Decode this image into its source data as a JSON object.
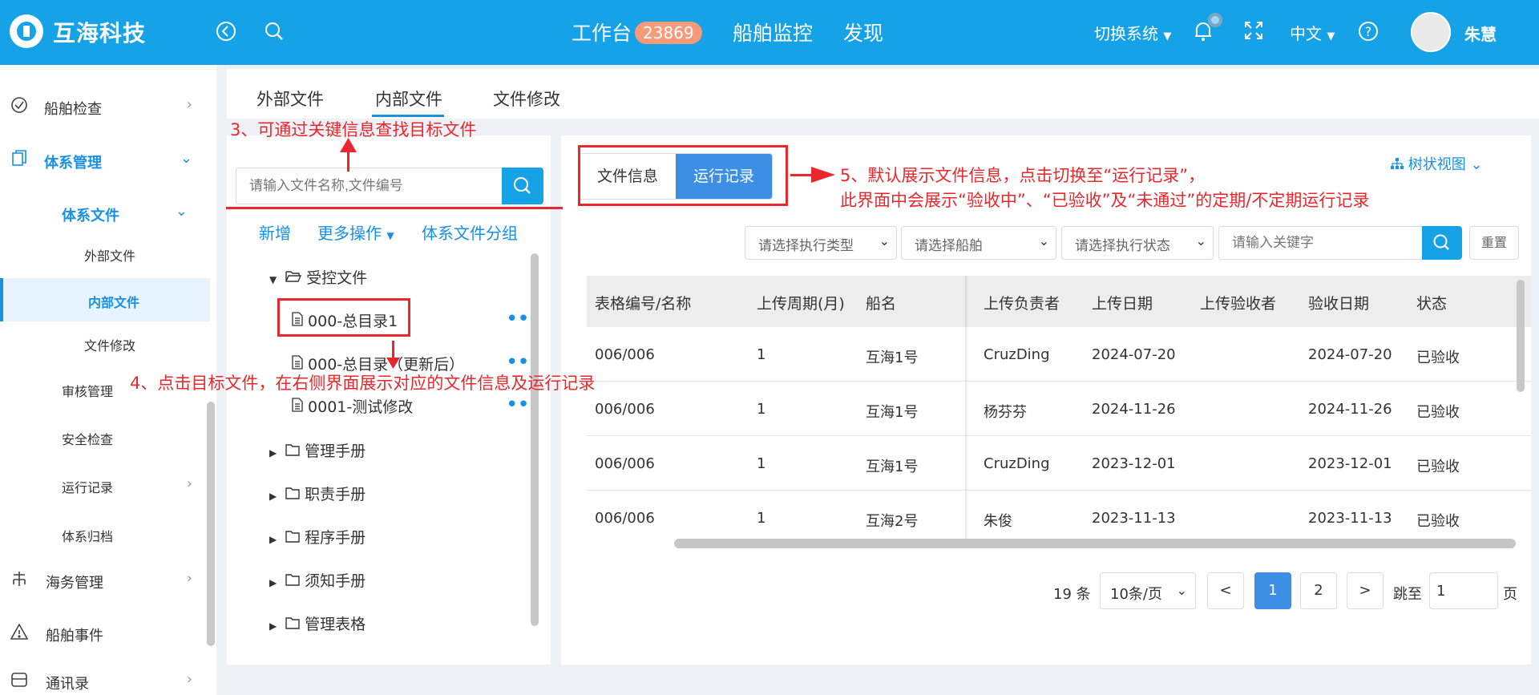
{
  "header": {
    "brand": "互海科技",
    "nav": [
      "工作台",
      "船舶监控",
      "发现"
    ],
    "badge": "23869",
    "switch_system": "切换系统",
    "language": "中文",
    "user": "朱慧"
  },
  "sidebar": {
    "items": [
      {
        "label": "船舶检查"
      },
      {
        "label": "体系管理"
      },
      {
        "label": "体系文件"
      },
      {
        "label": "外部文件"
      },
      {
        "label": "内部文件"
      },
      {
        "label": "文件修改"
      },
      {
        "label": "审核管理"
      },
      {
        "label": "安全检查"
      },
      {
        "label": "运行记录"
      },
      {
        "label": "体系归档"
      },
      {
        "label": "海务管理"
      },
      {
        "label": "船舶事件"
      },
      {
        "label": "通讯录"
      }
    ]
  },
  "tabs": [
    "外部文件",
    "内部文件",
    "文件修改"
  ],
  "left": {
    "search_placeholder": "请输入文件名称,文件编号",
    "actions": [
      "新增",
      "更多操作",
      "体系文件分组"
    ],
    "tree": {
      "root": "受控文件",
      "files": [
        "000-总目录1",
        "000-总目录（更新后）",
        "0001-测试修改"
      ],
      "folders": [
        "管理手册",
        "职责手册",
        "程序手册",
        "须知手册",
        "管理表格"
      ]
    }
  },
  "right": {
    "segments": [
      "文件信息",
      "运行记录"
    ],
    "tree_view": "树状视图",
    "filters": [
      "请选择执行类型",
      "请选择船舶",
      "请选择执行状态"
    ],
    "keyword_placeholder": "请输入关键字",
    "reset": "重置",
    "columns": [
      "表格编号/名称",
      "上传周期(月)",
      "船名",
      "上传负责者",
      "上传日期",
      "上传验收者",
      "验收日期",
      "状态"
    ],
    "rows": [
      [
        "006/006",
        "1",
        "互海1号",
        "CruzDing",
        "2024-07-20",
        "",
        "2024-07-20",
        "已验收"
      ],
      [
        "006/006",
        "1",
        "互海1号",
        "杨芬芬",
        "2024-11-26",
        "",
        "2024-11-26",
        "已验收"
      ],
      [
        "006/006",
        "1",
        "互海1号",
        "CruzDing",
        "2023-12-01",
        "",
        "2023-12-01",
        "已验收"
      ],
      [
        "006/006",
        "1",
        "互海2号",
        "朱俊",
        "2023-11-13",
        "",
        "2023-11-13",
        "已验收"
      ]
    ],
    "pagination": {
      "total": "19 条",
      "page_size": "10条/页",
      "prev": "<",
      "pages": [
        "1",
        "2"
      ],
      "next": ">",
      "jump_label": "跳至",
      "jump_value": "1",
      "page_unit": "页"
    }
  },
  "annotations": {
    "a3": "3、可通过关键信息查找目标文件",
    "a4": "4、点击目标文件，在右侧界面展示对应的文件信息及运行记录",
    "a5_line1": "5、默认展示文件信息，点击切换至“运行记录”，",
    "a5_line2": "此界面中会展示“验收中”、“已验收”及“未通过”的定期/不定期运行记录"
  },
  "colors": {
    "header": "#16a2e6",
    "accent": "#3d8fe6",
    "annotation": "#e8282c"
  }
}
